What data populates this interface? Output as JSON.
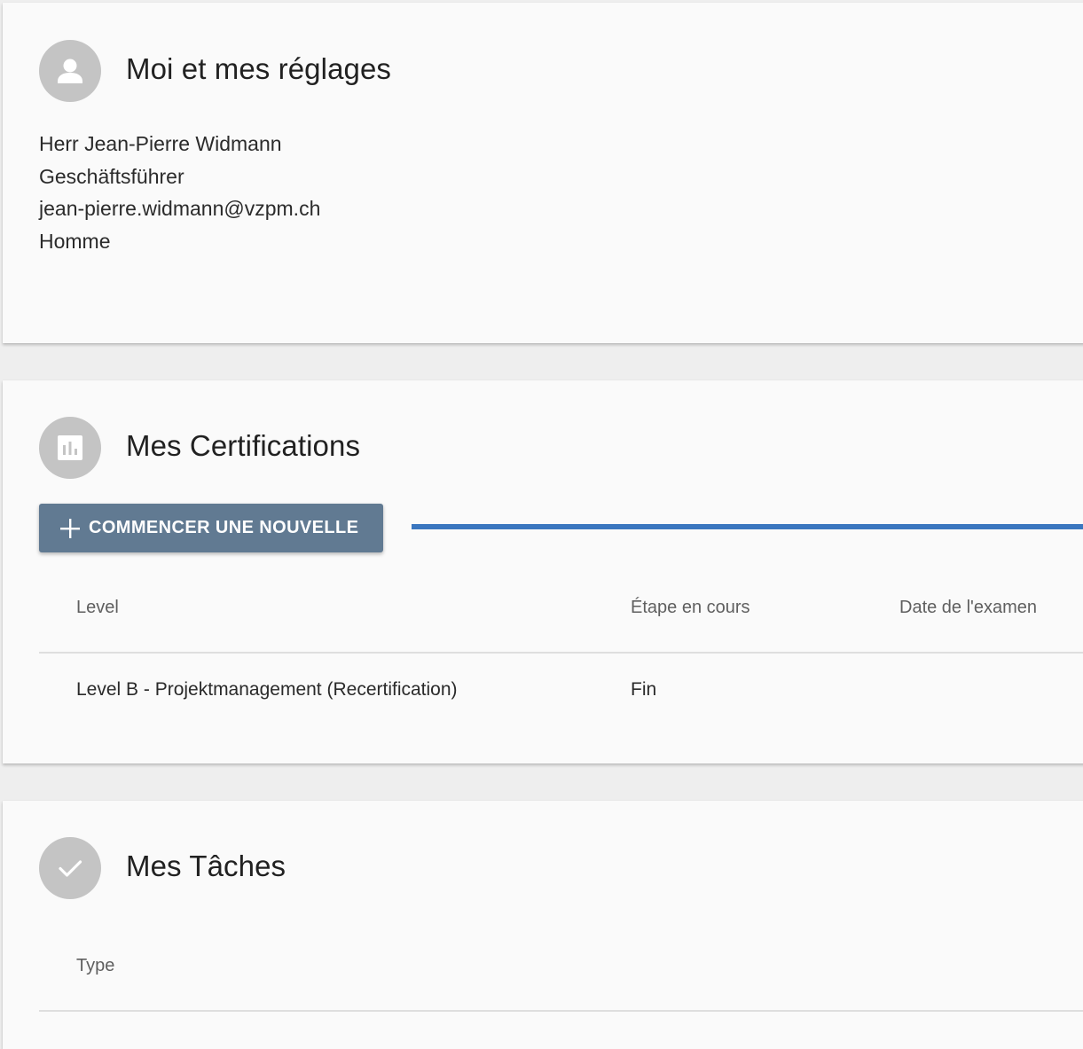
{
  "profile": {
    "title": "Moi et mes réglages",
    "avatar_icon": "person-icon",
    "name": "Herr Jean-Pierre Widmann",
    "role": "Geschäftsführer",
    "email": "jean-pierre.widmann@vzpm.ch",
    "gender": "Homme"
  },
  "certifications": {
    "title": "Mes Certifications",
    "avatar_icon": "bar-chart-icon",
    "new_button_label": "COMMENCER UNE NOUVELLE",
    "new_button_icon": "plus-icon",
    "columns": [
      "Level",
      "Étape en cours",
      "Date de l'examen"
    ],
    "rows": [
      {
        "level": "Level B - Projektmanagement (Recertification)",
        "stage": "Fin",
        "exam_date": ""
      }
    ]
  },
  "tasks": {
    "title": "Mes Tâches",
    "avatar_icon": "check-icon",
    "columns": [
      "Type"
    ]
  },
  "colors": {
    "button_bg": "#617a92",
    "progress_accent": "#3a76bf",
    "avatar_bg": "#c4c4c4",
    "card_bg": "#fafafa"
  }
}
